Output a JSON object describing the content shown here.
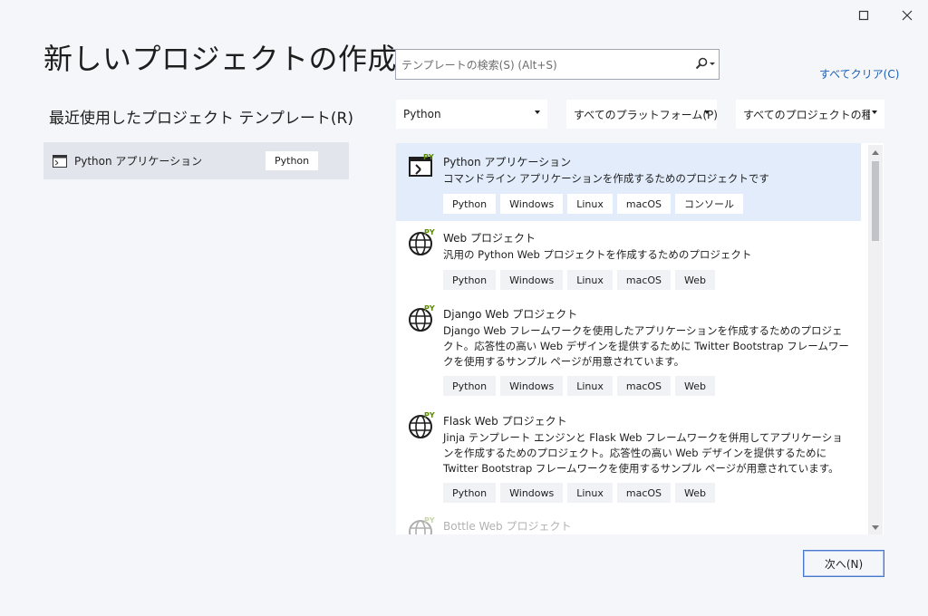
{
  "window": {
    "maximize_icon": "maximize-icon",
    "close_icon": "close-icon"
  },
  "header": {
    "title": "新しいプロジェクトの作成"
  },
  "recent": {
    "heading": "最近使用したプロジェクト テンプレート(R)",
    "items": [
      {
        "label": "Python アプリケーション",
        "tag": "Python",
        "icon": "console-app-icon"
      }
    ]
  },
  "search": {
    "placeholder": "テンプレートの検索(S) (Alt+S)",
    "icon": "search-icon",
    "clear_all": "すべてクリア(C)"
  },
  "filters": {
    "language": "Python",
    "platform": "すべてのプラットフォーム(P)",
    "project_type": "すべてのプロジェクトの種類..."
  },
  "templates": [
    {
      "name": "Python アプリケーション",
      "description": "コマンドライン アプリケーションを作成するためのプロジェクトです",
      "tags": [
        "Python",
        "Windows",
        "Linux",
        "macOS",
        "コンソール"
      ],
      "icon": "python-console-icon",
      "selected": true
    },
    {
      "name": "Web プロジェクト",
      "description": "汎用の Python Web プロジェクトを作成するためのプロジェクト",
      "tags": [
        "Python",
        "Windows",
        "Linux",
        "macOS",
        "Web"
      ],
      "icon": "python-web-globe-icon"
    },
    {
      "name": "Django Web プロジェクト",
      "description": "Django Web フレームワークを使用したアプリケーションを作成するためのプロジェクト。応答性の高い Web デザインを提供するために Twitter Bootstrap フレームワークを使用するサンプル ページが用意されています。",
      "tags": [
        "Python",
        "Windows",
        "Linux",
        "macOS",
        "Web"
      ],
      "icon": "python-web-globe-icon"
    },
    {
      "name": "Flask Web プロジェクト",
      "description": "Jinja テンプレート エンジンと Flask Web フレームワークを併用してアプリケーションを作成するためのプロジェクト。応答性の高い Web デザインを提供するために Twitter Bootstrap フレームワークを使用するサンプル ページが用意されています。",
      "tags": [
        "Python",
        "Windows",
        "Linux",
        "macOS",
        "Web"
      ],
      "icon": "python-web-globe-icon"
    },
    {
      "name": "Bottle Web プロジェクト",
      "icon": "python-web-globe-icon"
    }
  ],
  "footer": {
    "next_label": "次へ(N)"
  }
}
